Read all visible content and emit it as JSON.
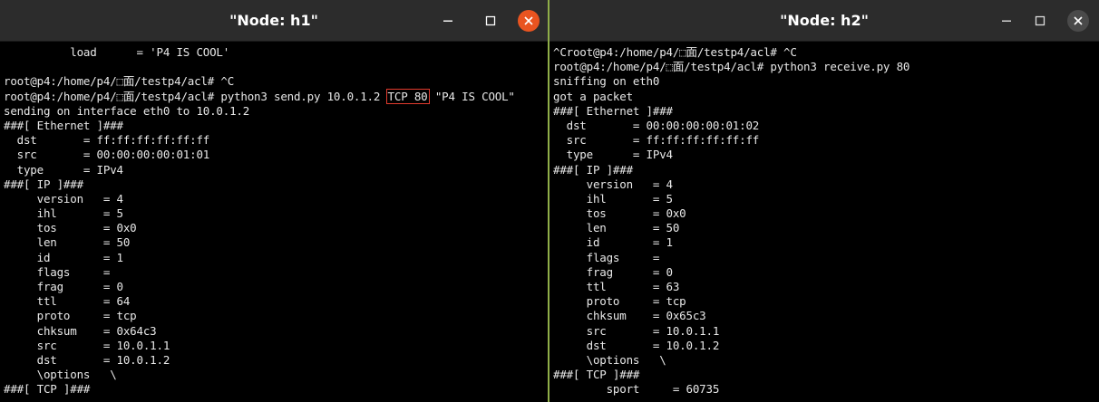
{
  "windows": {
    "h1": {
      "title": "\"Node: h1\"",
      "lines": [
        "          load      = 'P4 IS COOL'",
        "",
        "root@p4:/home/p4/⬚面/testp4/acl# ^C",
        {
          "parts": [
            "root@p4:/home/p4/⬚面/testp4/acl# python3 send.py 10.0.1.2 ",
            "TCP 80",
            " \"P4 IS COOL\""
          ],
          "highlight_index": 1
        },
        "sending on interface eth0 to 10.0.1.2",
        "###[ Ethernet ]###",
        "  dst       = ff:ff:ff:ff:ff:ff",
        "  src       = 00:00:00:00:01:01",
        "  type      = IPv4",
        "###[ IP ]###",
        "     version   = 4",
        "     ihl       = 5",
        "     tos       = 0x0",
        "     len       = 50",
        "     id        = 1",
        "     flags     =",
        "     frag      = 0",
        "     ttl       = 64",
        "     proto     = tcp",
        "     chksum    = 0x64c3",
        "     src       = 10.0.1.1",
        "     dst       = 10.0.1.2",
        "     \\options   \\",
        "###[ TCP ]###"
      ]
    },
    "h2": {
      "title": "\"Node: h2\"",
      "lines": [
        "^Croot@p4:/home/p4/⬚面/testp4/acl# ^C",
        "root@p4:/home/p4/⬚面/testp4/acl# python3 receive.py 80",
        "sniffing on eth0",
        "got a packet",
        "###[ Ethernet ]###",
        "  dst       = 00:00:00:00:01:02",
        "  src       = ff:ff:ff:ff:ff:ff",
        "  type      = IPv4",
        "###[ IP ]###",
        "     version   = 4",
        "     ihl       = 5",
        "     tos       = 0x0",
        "     len       = 50",
        "     id        = 1",
        "     flags     =",
        "     frag      = 0",
        "     ttl       = 63",
        "     proto     = tcp",
        "     chksum    = 0x65c3",
        "     src       = 10.0.1.1",
        "     dst       = 10.0.1.2",
        "     \\options   \\",
        "###[ TCP ]###",
        "        sport     = 60735"
      ]
    }
  },
  "icons": {
    "minimize": "minimize-icon",
    "maximize": "maximize-icon",
    "close": "close-icon"
  },
  "colors": {
    "highlight_box": "#e23b2e",
    "close_active": "#e95420",
    "terminal_bg": "#000000",
    "terminal_fg": "#e8e8e8",
    "titlebar_bg": "#2c2c2c"
  }
}
